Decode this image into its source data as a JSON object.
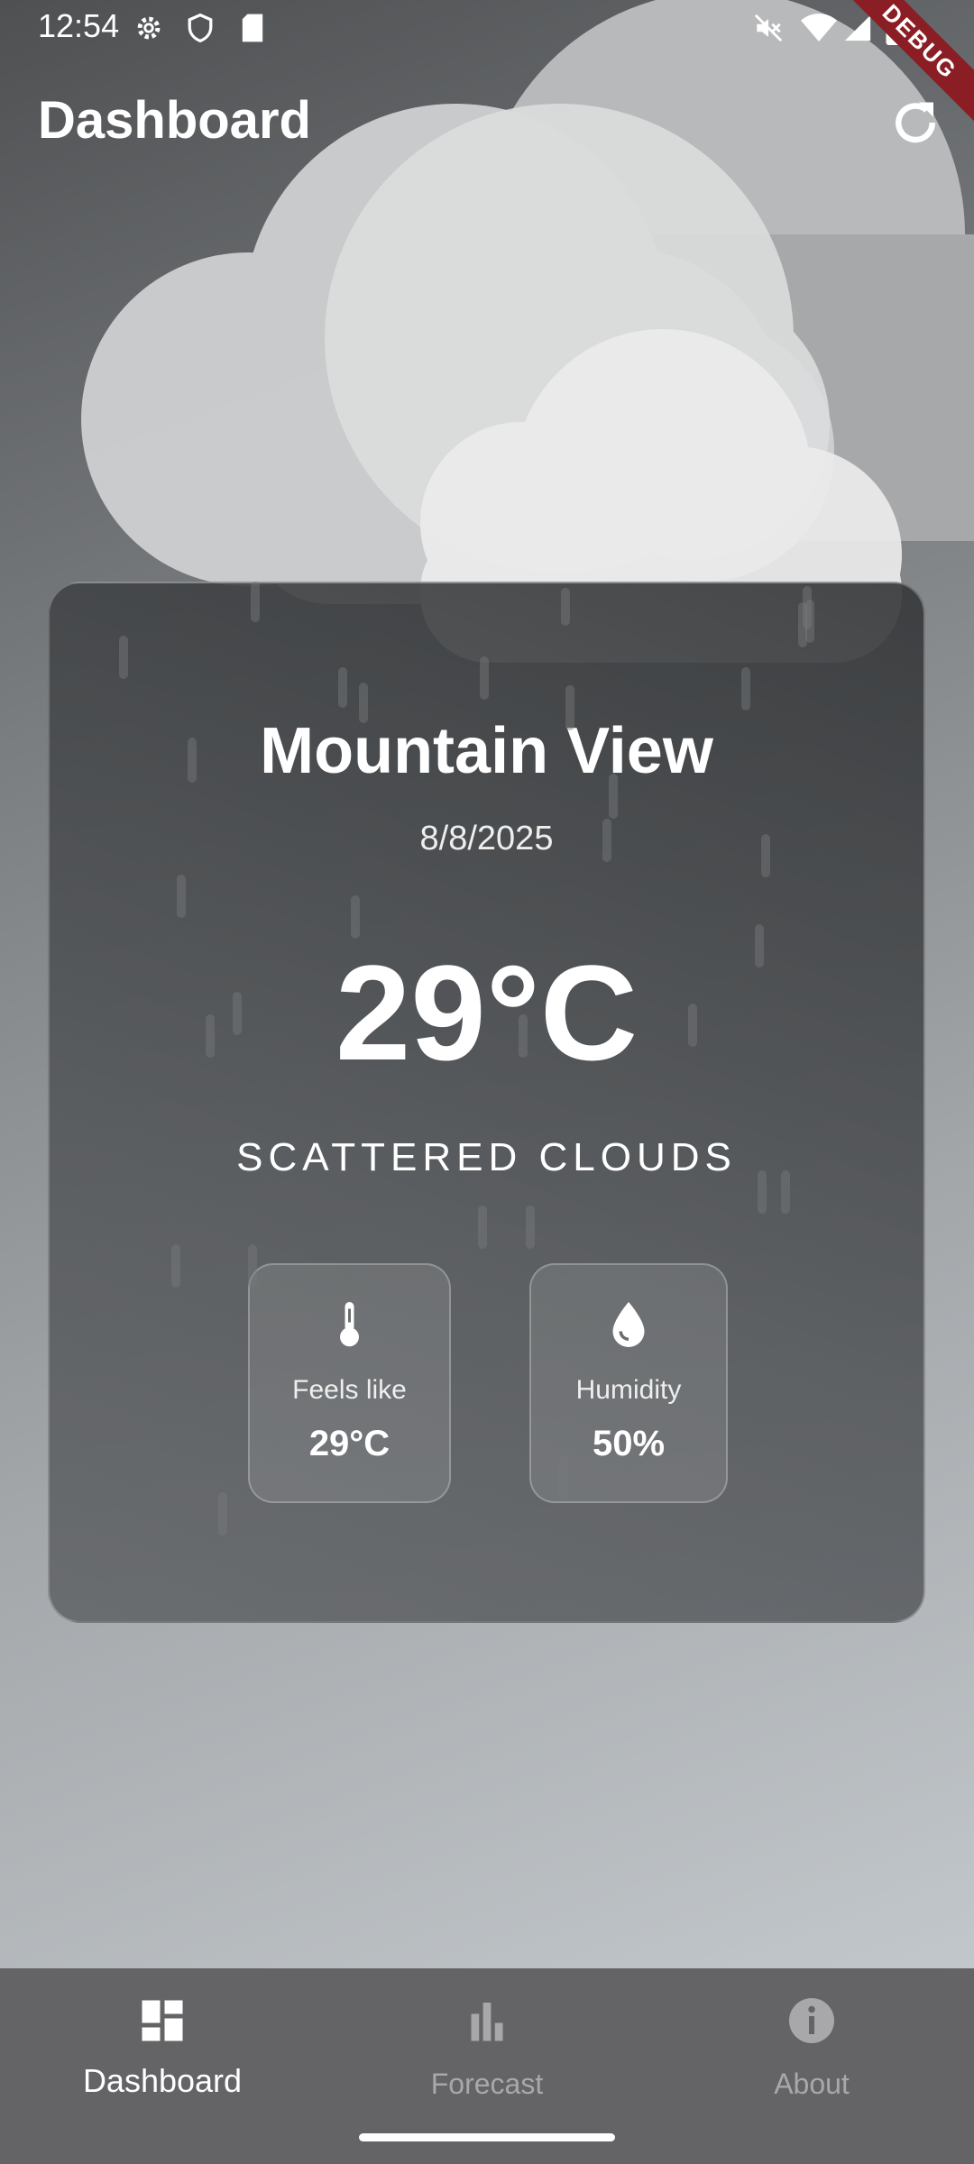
{
  "status_bar": {
    "time": "12:54",
    "debug_label": "DEBUG"
  },
  "app_bar": {
    "title": "Dashboard"
  },
  "weather": {
    "city": "Mountain View",
    "date": "8/8/2025",
    "temperature": "29°C",
    "description": "SCATTERED CLOUDS",
    "stats": [
      {
        "label": "Feels like",
        "value": "29°C",
        "icon": "thermometer-icon"
      },
      {
        "label": "Humidity",
        "value": "50%",
        "icon": "water-drop-icon"
      }
    ]
  },
  "bottom_nav": {
    "items": [
      {
        "label": "Dashboard",
        "icon": "dashboard-icon",
        "active": true
      },
      {
        "label": "Forecast",
        "icon": "bar-chart-icon",
        "active": false
      },
      {
        "label": "About",
        "icon": "info-icon",
        "active": false
      }
    ]
  },
  "colors": {
    "nav_bg": "#646466",
    "debug_ribbon": "#8b1e24"
  }
}
